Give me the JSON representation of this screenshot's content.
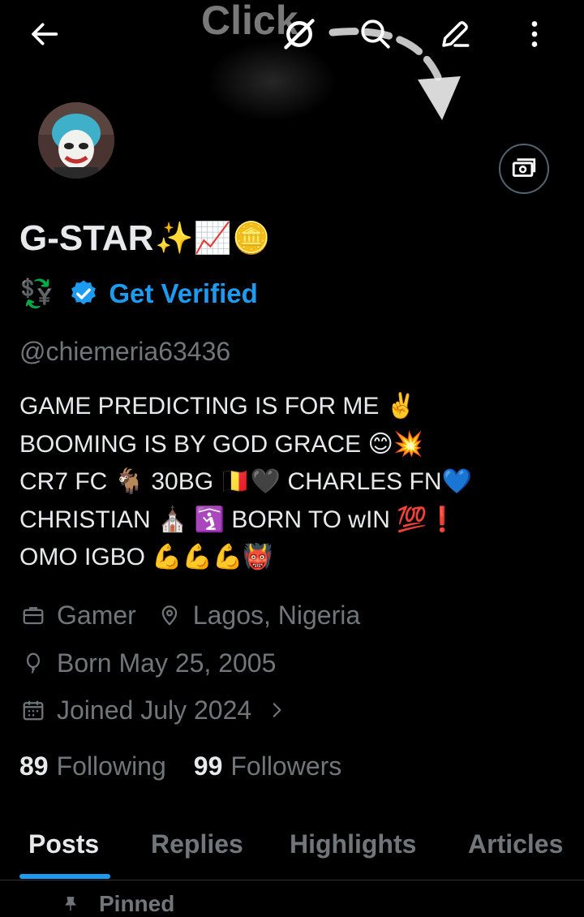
{
  "overlay": {
    "click_text": "Click"
  },
  "header": {
    "back_icon": "arrow-left-icon",
    "grok_icon": "grok-icon",
    "search_icon": "search-icon",
    "edit_icon": "pencil-icon",
    "more_icon": "more-vertical-icon"
  },
  "profile": {
    "display_name": "G-STAR",
    "name_emojis": "✨📈🪙",
    "name_emoji_2": "💱",
    "get_verified_label": "Get Verified",
    "handle": "@chiemeria63436",
    "bio_lines": [
      "GAME PREDICTING IS FOR ME ✌️",
      "BOOMING IS BY GOD GRACE 😊💥",
      "CR7 FC 🐐 30BG  🇧🇪🖤 CHARLES FN💙",
      "CHRISTIAN ⛪ 🛐 BORN TO wIN 💯❗",
      "OMO IGBO 💪💪💪👹"
    ],
    "profession": "Gamer",
    "location": "Lagos, Nigeria",
    "birthday": "Born May 25, 2005",
    "joined": "Joined July 2024",
    "following_count": "89",
    "following_label": "Following",
    "followers_count": "99",
    "followers_label": "Followers"
  },
  "tabs": [
    {
      "label": "Posts",
      "active": true
    },
    {
      "label": "Replies",
      "active": false
    },
    {
      "label": "Highlights",
      "active": false
    },
    {
      "label": "Articles",
      "active": false
    }
  ],
  "pinned_label": "Pinned",
  "colors": {
    "background": "#000000",
    "text_primary": "#e7e9ea",
    "text_secondary": "#71767b",
    "accent": "#1d9bf0",
    "divider": "#2f3336"
  }
}
